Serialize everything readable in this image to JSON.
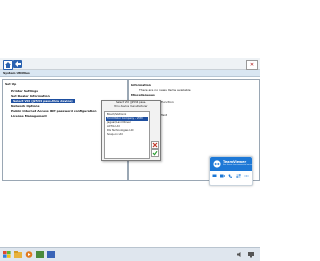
{
  "toolbar": {
    "close_label": "✕"
  },
  "window": {
    "title": "System Utilities"
  },
  "left_panel": {
    "header": "Set Up",
    "items": [
      {
        "label": "Printer Settings",
        "selected": false
      },
      {
        "label": "Set Dealer Information",
        "selected": false
      },
      {
        "label": "Select VCI (J2534 pass-thru device)",
        "selected": true
      },
      {
        "label": "Network Options",
        "selected": false
      },
      {
        "label": "Public Internet Access IDP password configuration",
        "selected": false
      },
      {
        "label": "License Management",
        "selected": false
      }
    ]
  },
  "right_panel": {
    "info_title": "Information",
    "info_text": "There are no news items available",
    "misc_title": "Miscellaneous",
    "function_label": "Function",
    "text_label": "Text"
  },
  "popup": {
    "title_line1": "Select VCI (J2534 pass-",
    "title_line2": "thru device manufacturer",
    "options": [
      {
        "label": "Bosch/Vetronix",
        "selected": false
      },
      {
        "label": "Ford Motor Company - VCM",
        "selected": true
      },
      {
        "label": "Jaguar/Land Rover",
        "selected": false
      },
      {
        "label": "ACTIA Ltd",
        "selected": false
      },
      {
        "label": "DG Technologies Ltd",
        "selected": false
      },
      {
        "label": "Snap-on Ltd",
        "selected": false
      }
    ]
  },
  "teamviewer": {
    "name": "TeamViewer",
    "status": "Free license (non-commercial use only)"
  },
  "colors": {
    "accent_blue": "#1e4fa0",
    "teamviewer_blue": "#1d78d6",
    "cancel_red": "#c0392b",
    "ok_green": "#2e9e35"
  }
}
